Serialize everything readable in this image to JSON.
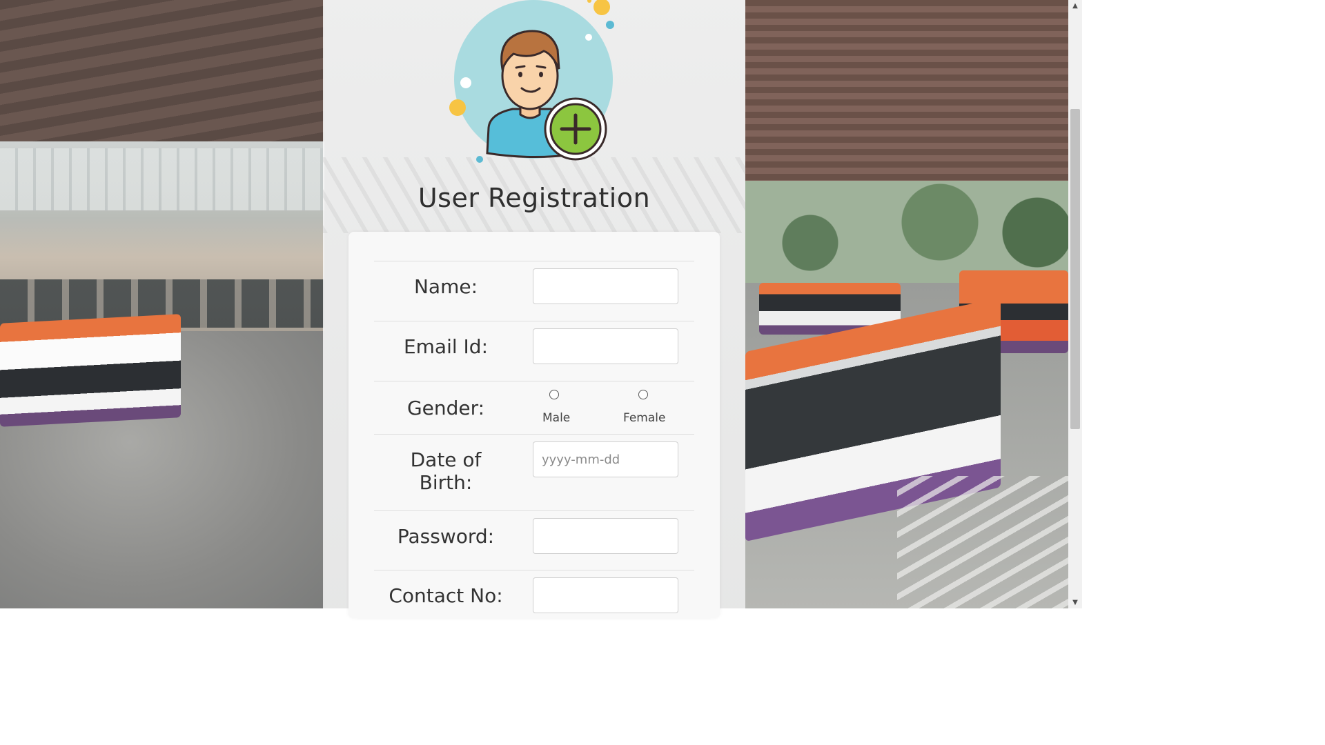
{
  "page": {
    "title": "User Registration"
  },
  "form": {
    "name_label": "Name:",
    "name_value": "",
    "email_label": "Email Id:",
    "email_value": "",
    "gender_label": "Gender:",
    "gender_options": [
      "Male",
      "Female"
    ],
    "dob_label_line1": "Date of",
    "dob_label_line2": "Birth:",
    "dob_placeholder": "yyyy-mm-dd",
    "password_label": "Password:",
    "password_value": "",
    "contact_label": "Contact No:",
    "contact_value": ""
  },
  "icons": {
    "avatar": "user-add-avatar-icon",
    "plus": "plus-icon",
    "scroll_up": "scroll-up-arrow-icon",
    "scroll_down": "scroll-down-arrow-icon"
  },
  "colors": {
    "avatar_circle": "#a9dbe0",
    "plus_badge": "#8cc63f",
    "accent_dot": "#f7c443"
  }
}
